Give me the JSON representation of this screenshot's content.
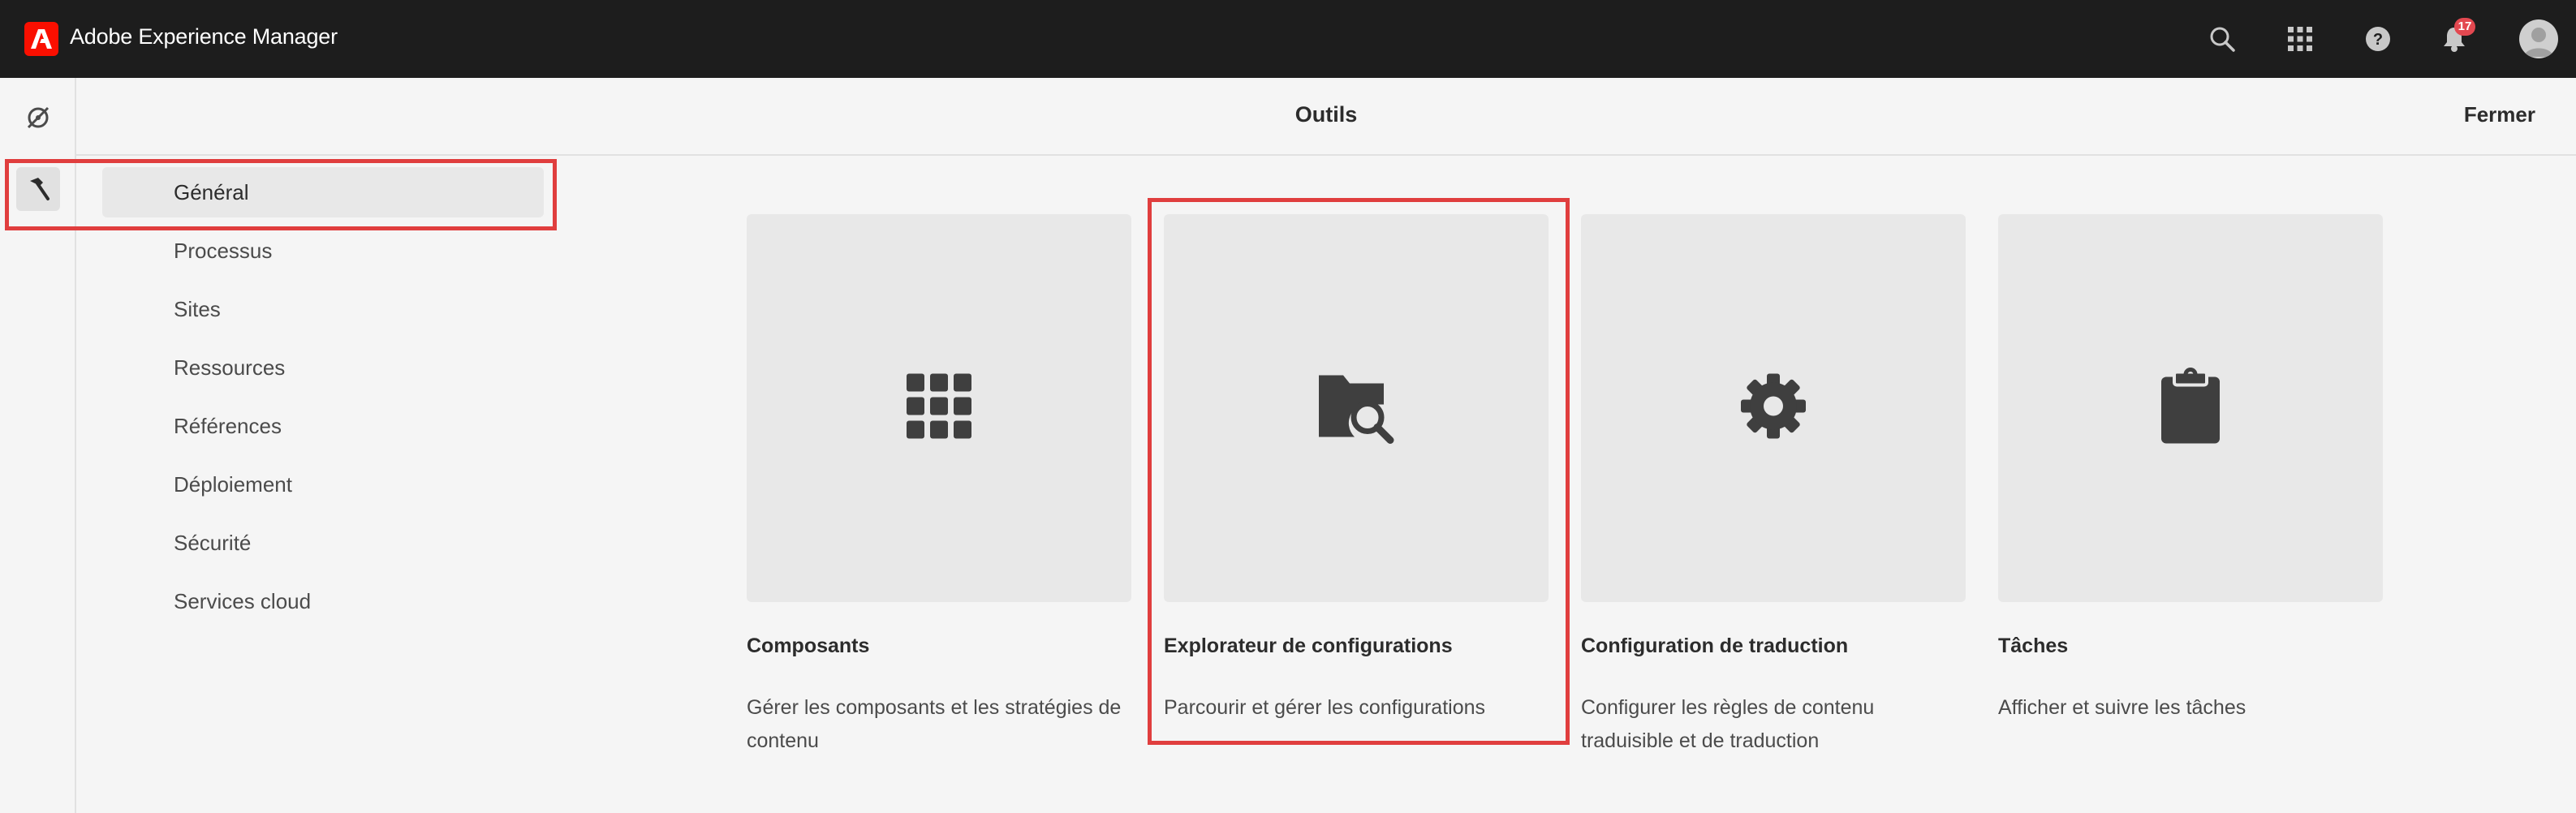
{
  "shell": {
    "app_title": "Adobe Experience Manager",
    "notification_count": "17",
    "actions": [
      "search-icon",
      "apps-icon",
      "help-icon",
      "bell-icon",
      "avatar"
    ]
  },
  "rail": {
    "items": [
      "navigation-icon",
      "tools-hammer-icon"
    ],
    "active": "tools-hammer-icon"
  },
  "header": {
    "title": "Outils",
    "close_label": "Fermer"
  },
  "nav": {
    "items": [
      {
        "label": "Général"
      },
      {
        "label": "Processus"
      },
      {
        "label": "Sites"
      },
      {
        "label": "Ressources"
      },
      {
        "label": "Références"
      },
      {
        "label": "Déploiement"
      },
      {
        "label": "Sécurité"
      },
      {
        "label": "Services cloud"
      }
    ],
    "selected": "Général"
  },
  "cards": [
    {
      "title": "Composants",
      "desc": "Gérer les composants et les stratégies de contenu",
      "icon": "grid-icon"
    },
    {
      "title": "Explorateur de configurations",
      "desc": "Parcourir et gérer les configurations",
      "icon": "folder-search-icon"
    },
    {
      "title": "Configuration de traduction",
      "desc": "Configurer les règles de contenu traduisible et de traduction",
      "icon": "gear-icon"
    },
    {
      "title": "Tâches",
      "desc": "Afficher et suivre les tâches",
      "icon": "clipboard-icon"
    }
  ],
  "colors": {
    "shell_bg": "#1d1d1d",
    "brand_red": "#fa0f00",
    "highlight": "#e03e3e",
    "card_bg": "#e8e8e8"
  }
}
